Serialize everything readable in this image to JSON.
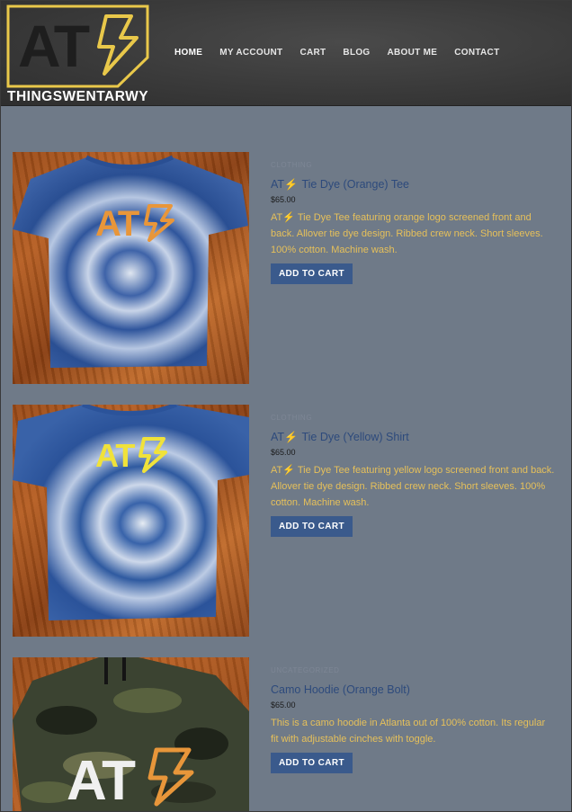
{
  "brand": {
    "logo_text": "AT",
    "name": "THINGSWENTARWY"
  },
  "nav": {
    "items": [
      {
        "label": "HOME",
        "active": true
      },
      {
        "label": "MY ACCOUNT",
        "active": false
      },
      {
        "label": "CART",
        "active": false
      },
      {
        "label": "BLOG",
        "active": false
      },
      {
        "label": "ABOUT ME",
        "active": false
      },
      {
        "label": "CONTACT",
        "active": false
      }
    ]
  },
  "products": [
    {
      "category": "CLOTHING",
      "title_prefix": "AT",
      "title": "Tie Dye (Orange) Tee",
      "price": "$65.00",
      "desc_prefix": "AT",
      "description": "Tie Dye Tee featuring orange logo screened front and back. Allover tie dye design. Ribbed crew neck. Short sleeves. 100% cotton. Machine wash.",
      "button": "ADD TO CART",
      "logo_color": "#e8963a"
    },
    {
      "category": "CLOTHING",
      "title_prefix": "AT",
      "title": "Tie Dye (Yellow) Shirt",
      "price": "$65.00",
      "desc_prefix": "AT",
      "description": "Tie Dye Tee featuring yellow logo screened front and back. Allover tie dye design. Ribbed crew neck. Short sleeves. 100% cotton. Machine wash.",
      "button": "ADD TO CART",
      "logo_color": "#f0e23a"
    },
    {
      "category": "UNCATEGORIZED",
      "title_prefix": "",
      "title": "Camo Hoodie (Orange Bolt)",
      "price": "$65.00",
      "desc_prefix": "",
      "description": "This is a camo hoodie in Atlanta out of 100% cotton. Its regular fit with adjustable cinches with toggle.",
      "button": "ADD TO CART",
      "logo_color": "#f0f0f0"
    }
  ],
  "colors": {
    "page_bg": "#6f7a88",
    "title": "#2d4a7c",
    "description": "#e6c05a",
    "button_bg": "#3a5a8c",
    "logo_frame": "#e9c84a"
  }
}
